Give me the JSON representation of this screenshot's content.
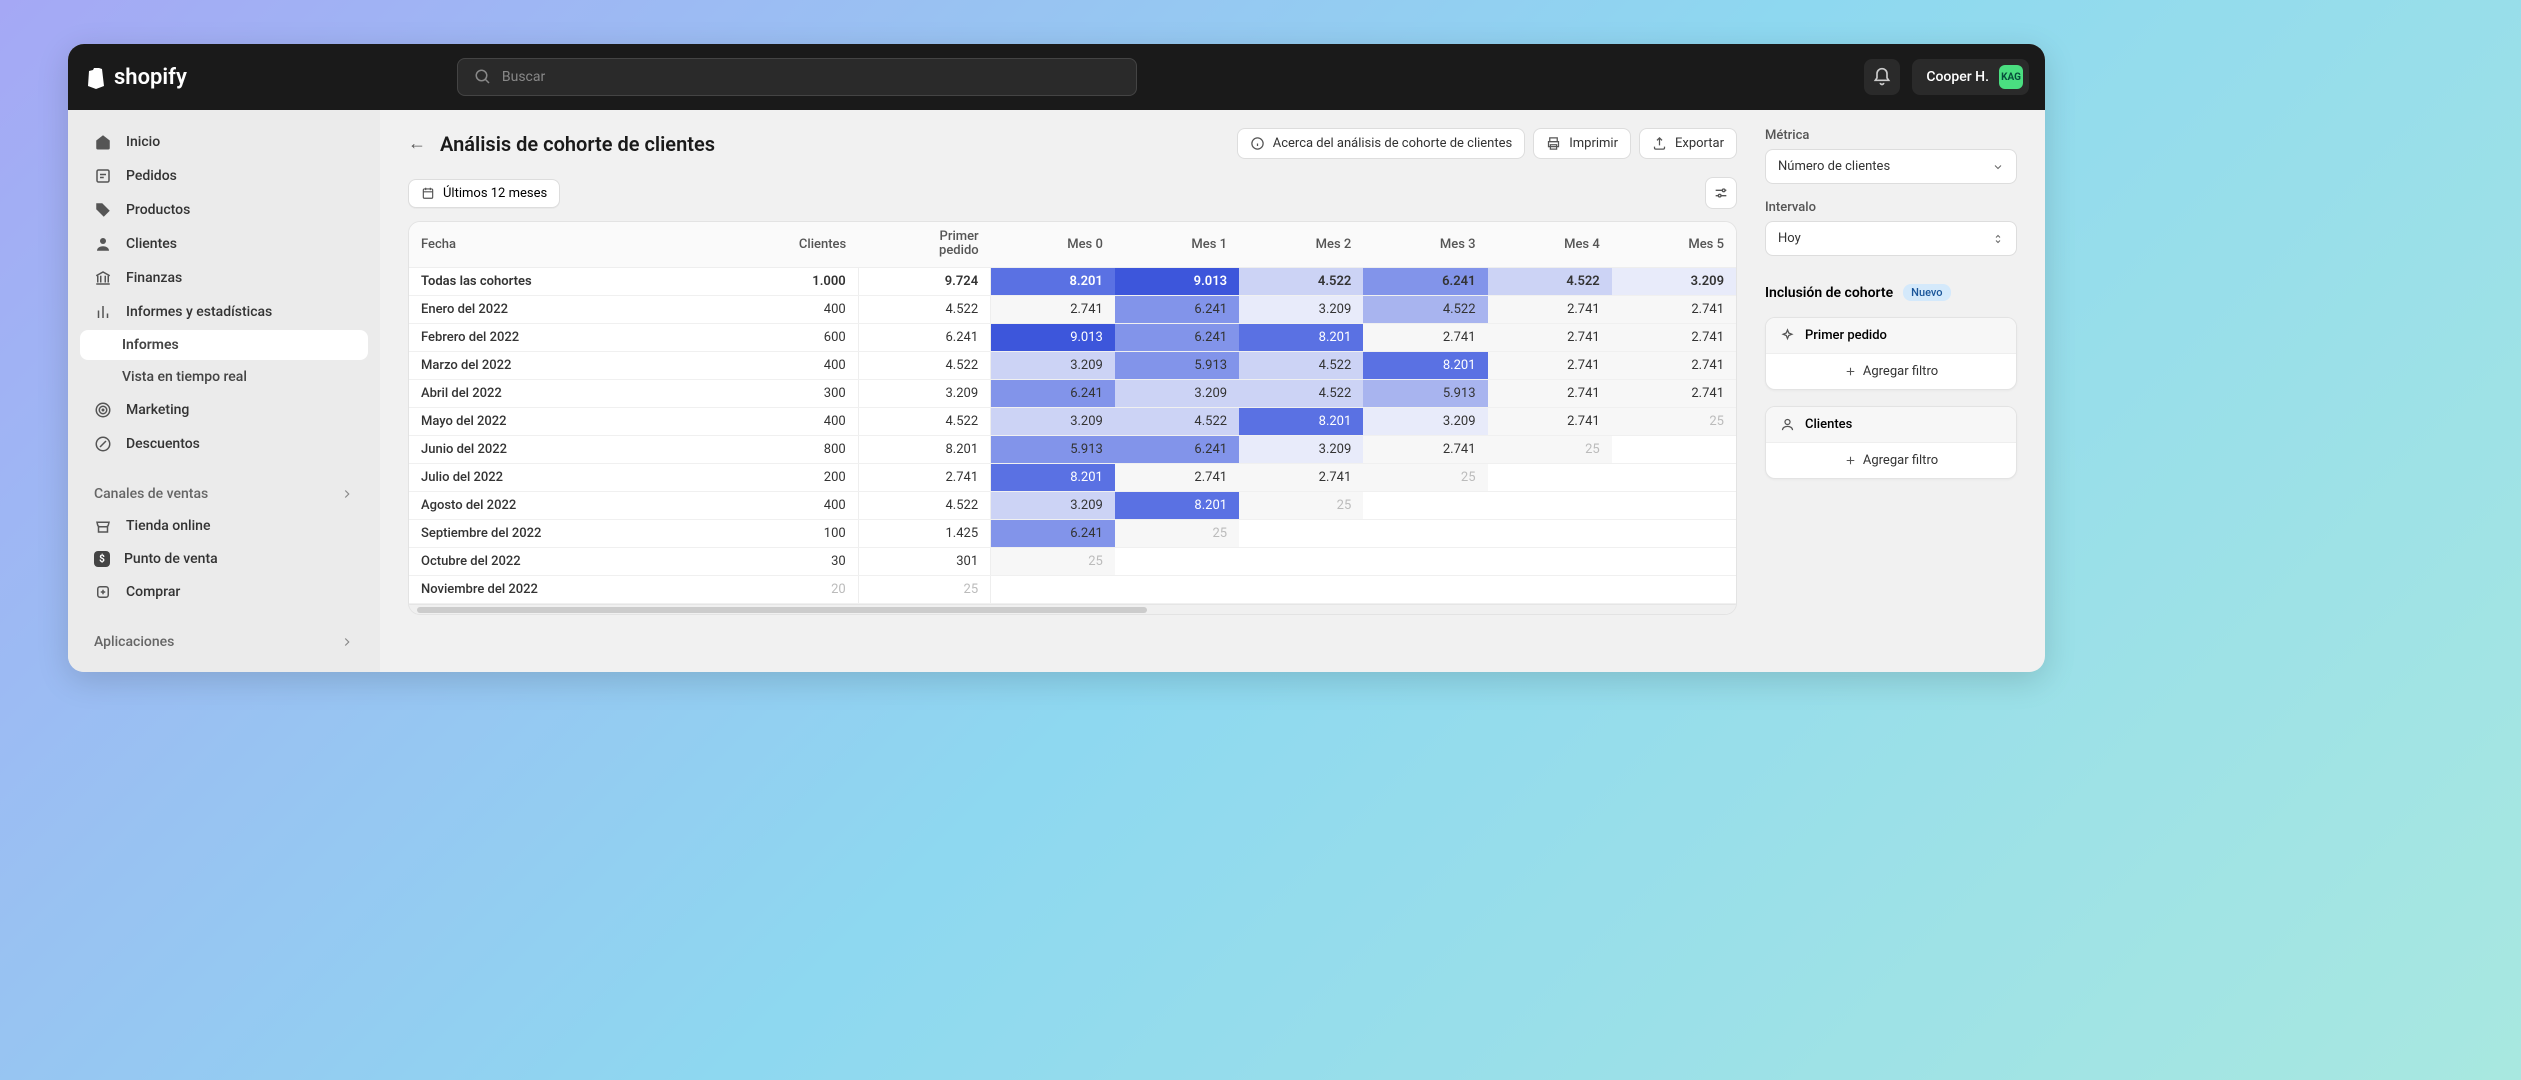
{
  "brand": "shopify",
  "search": {
    "placeholder": "Buscar"
  },
  "user": {
    "name": "Cooper H.",
    "initials": "KAG"
  },
  "sidebar": {
    "items": [
      {
        "label": "Inicio"
      },
      {
        "label": "Pedidos"
      },
      {
        "label": "Productos"
      },
      {
        "label": "Clientes"
      },
      {
        "label": "Finanzas"
      },
      {
        "label": "Informes y estadísticas"
      },
      {
        "label": "Informes"
      },
      {
        "label": "Vista en tiempo real"
      },
      {
        "label": "Marketing"
      },
      {
        "label": "Descuentos"
      }
    ],
    "channels_label": "Canales de ventas",
    "channels": [
      {
        "label": "Tienda online"
      },
      {
        "label": "Punto de venta"
      },
      {
        "label": "Comprar"
      }
    ],
    "apps_label": "Aplicaciones"
  },
  "page": {
    "title": "Análisis de cohorte de clientes",
    "about": "Acerca del análisis de cohorte de clientes",
    "print": "Imprimir",
    "export": "Exportar",
    "range": "Últimos 12 meses"
  },
  "right": {
    "metric_label": "Métrica",
    "metric_value": "Número de clientes",
    "interval_label": "Intervalo",
    "interval_value": "Hoy",
    "cohort_label": "Inclusión de cohorte",
    "new_badge": "Nuevo",
    "filter1": "Primer pedido",
    "filter2": "Clientes",
    "add_filter": "Agregar filtro"
  },
  "table": {
    "headers": [
      "Fecha",
      "Clientes",
      "Primer pedido",
      "Mes 0",
      "Mes 1",
      "Mes 2",
      "Mes 3",
      "Mes 4",
      "Mes 5"
    ],
    "primer_line1": "Primer",
    "primer_line2": "pedido",
    "rows": [
      {
        "label": "Todas las cohortes",
        "clients": "1.000",
        "primer": "9.724",
        "m": [
          {
            "v": "8.201",
            "h": 5
          },
          {
            "v": "9.013",
            "h": 6
          },
          {
            "v": "4.522",
            "h": 2
          },
          {
            "v": "6.241",
            "h": 4
          },
          {
            "v": "4.522",
            "h": 2
          },
          {
            "v": "3.209",
            "h": 1
          }
        ],
        "total": true
      },
      {
        "label": "Enero del 2022",
        "clients": "400",
        "primer": "4.522",
        "m": [
          {
            "v": "2.741",
            "h": 0
          },
          {
            "v": "6.241",
            "h": 4
          },
          {
            "v": "3.209",
            "h": 1
          },
          {
            "v": "4.522",
            "h": 3
          },
          {
            "v": "2.741",
            "h": 0
          },
          {
            "v": "2.741",
            "h": 0
          }
        ]
      },
      {
        "label": "Febrero del 2022",
        "clients": "600",
        "primer": "6.241",
        "m": [
          {
            "v": "9.013",
            "h": 6
          },
          {
            "v": "6.241",
            "h": 4
          },
          {
            "v": "8.201",
            "h": 5
          },
          {
            "v": "2.741",
            "h": 0
          },
          {
            "v": "2.741",
            "h": 0
          },
          {
            "v": "2.741",
            "h": 0
          }
        ]
      },
      {
        "label": "Marzo del 2022",
        "clients": "400",
        "primer": "4.522",
        "m": [
          {
            "v": "3.209",
            "h": 2
          },
          {
            "v": "5.913",
            "h": 4
          },
          {
            "v": "4.522",
            "h": 2
          },
          {
            "v": "8.201",
            "h": 5
          },
          {
            "v": "2.741",
            "h": 0
          },
          {
            "v": "2.741",
            "h": 0
          }
        ]
      },
      {
        "label": "Abril del 2022",
        "clients": "300",
        "primer": "3.209",
        "m": [
          {
            "v": "6.241",
            "h": 4
          },
          {
            "v": "3.209",
            "h": 2
          },
          {
            "v": "4.522",
            "h": 2
          },
          {
            "v": "5.913",
            "h": 3
          },
          {
            "v": "2.741",
            "h": 0
          },
          {
            "v": "2.741",
            "h": 0
          }
        ]
      },
      {
        "label": "Mayo del 2022",
        "clients": "400",
        "primer": "4.522",
        "m": [
          {
            "v": "3.209",
            "h": 2
          },
          {
            "v": "4.522",
            "h": 2
          },
          {
            "v": "8.201",
            "h": 5
          },
          {
            "v": "3.209",
            "h": 1
          },
          {
            "v": "2.741",
            "h": 0
          },
          {
            "v": "25",
            "h": 0,
            "dim": true
          }
        ]
      },
      {
        "label": "Junio del 2022",
        "clients": "800",
        "primer": "8.201",
        "m": [
          {
            "v": "5.913",
            "h": 4
          },
          {
            "v": "6.241",
            "h": 4
          },
          {
            "v": "3.209",
            "h": 1
          },
          {
            "v": "2.741",
            "h": 0
          },
          {
            "v": "25",
            "h": 0,
            "dim": true
          }
        ]
      },
      {
        "label": "Julio del 2022",
        "clients": "200",
        "primer": "2.741",
        "m": [
          {
            "v": "8.201",
            "h": 5
          },
          {
            "v": "2.741",
            "h": 0
          },
          {
            "v": "2.741",
            "h": 0
          },
          {
            "v": "25",
            "h": 0,
            "dim": true
          }
        ]
      },
      {
        "label": "Agosto del 2022",
        "clients": "400",
        "primer": "4.522",
        "m": [
          {
            "v": "3.209",
            "h": 2
          },
          {
            "v": "8.201",
            "h": 5
          },
          {
            "v": "25",
            "h": 0,
            "dim": true
          }
        ]
      },
      {
        "label": "Septiembre del 2022",
        "clients": "100",
        "primer": "1.425",
        "m": [
          {
            "v": "6.241",
            "h": 4
          },
          {
            "v": "25",
            "h": 0,
            "dim": true
          }
        ]
      },
      {
        "label": "Octubre del 2022",
        "clients": "30",
        "primer": "301",
        "m": [
          {
            "v": "25",
            "h": 0,
            "dim": true
          }
        ]
      },
      {
        "label": "Noviembre del 2022",
        "clients": "20",
        "primer": "25",
        "m": [],
        "dim_clients": true,
        "dim_primer": true
      }
    ]
  }
}
